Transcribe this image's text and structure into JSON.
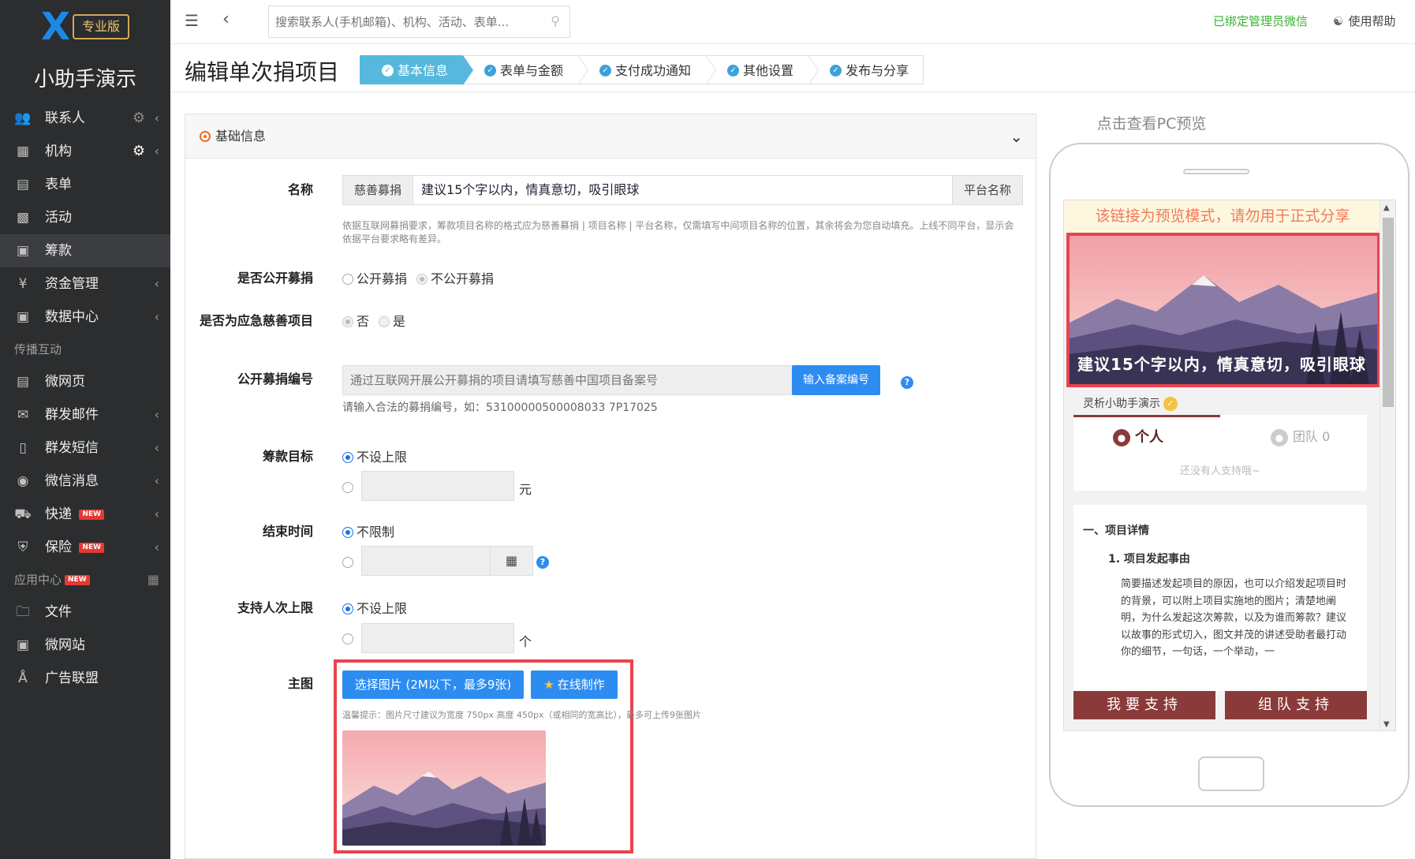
{
  "sidebar": {
    "logo_badge": "专业版",
    "app_name": "小助手演示",
    "items": [
      {
        "label": "联系人",
        "icon": "users-icon"
      },
      {
        "label": "机构",
        "icon": "building-icon"
      },
      {
        "label": "表单",
        "icon": "clipboard-icon"
      },
      {
        "label": "活动",
        "icon": "calendar-icon"
      },
      {
        "label": "筹款",
        "icon": "money-icon"
      },
      {
        "label": "资金管理",
        "icon": "yen-icon"
      },
      {
        "label": "数据中心",
        "icon": "data-icon"
      }
    ],
    "group_share": "传播互动",
    "share_items": [
      {
        "label": "微网页",
        "icon": "file-icon"
      },
      {
        "label": "群发邮件",
        "icon": "mail-icon"
      },
      {
        "label": "群发短信",
        "icon": "phone-icon"
      },
      {
        "label": "微信消息",
        "icon": "wechat-icon"
      },
      {
        "label": "快递",
        "icon": "truck-icon",
        "badge": "NEW"
      },
      {
        "label": "保险",
        "icon": "shield-icon",
        "badge": "NEW"
      }
    ],
    "group_apps": "应用中心",
    "group_apps_badge": "NEW",
    "app_items": [
      {
        "label": "文件",
        "icon": "folder-icon"
      },
      {
        "label": "微网站",
        "icon": "site-icon"
      },
      {
        "label": "广告联盟",
        "icon": "ad-icon"
      }
    ]
  },
  "topbar": {
    "search_placeholder": "搜索联系人(手机邮箱)、机构、活动、表单...",
    "wechat_bound": "已绑定管理员微信",
    "help": "使用帮助"
  },
  "page": {
    "title": "编辑单次捐项目",
    "steps": [
      "基本信息",
      "表单与金额",
      "支付成功通知",
      "其他设置",
      "发布与分享"
    ]
  },
  "form": {
    "section_title": "基础信息",
    "name_label": "名称",
    "name_prefix": "慈善募捐",
    "name_value": "建议15个字以内，情真意切，吸引眼球",
    "name_suffix": "平台名称",
    "name_hint": "依据互联网募捐要求，筹款项目名称的格式应为慈善募捐 | 项目名称 | 平台名称，仅需填写中间项目名称的位置，其余将会为您自动填充。上线不同平台，显示会依据平台要求略有差异。",
    "public_label": "是否公开募捐",
    "public_opt1": "公开募捐",
    "public_opt2": "不公开募捐",
    "emergency_label": "是否为应急慈善项目",
    "emergency_opt1": "否",
    "emergency_opt2": "是",
    "record_label": "公开募捐编号",
    "record_placeholder": "通过互联网开展公开募捐的项目请填写慈善中国项目备案号",
    "record_button": "输入备案编号",
    "record_hint": "请输入合法的募捐编号，如：53100000500008033 7P17025",
    "goal_label": "筹款目标",
    "goal_opt1": "不设上限",
    "goal_unit": "元",
    "end_label": "结束时间",
    "end_opt1": "不限制",
    "limit_label": "支持人次上限",
    "limit_opt1": "不设上限",
    "limit_unit": "个",
    "image_label": "主图",
    "image_select": "选择图片 (2M以下，最多9张)",
    "image_online": "在线制作",
    "image_hint": "温馨提示：图片尺寸建议为宽度 750px 高度 450px（或相同的宽高比），最多可上传9张图片"
  },
  "preview": {
    "title": "点击查看PC预览",
    "warning": "该链接为预览模式，请勿用于正式分享",
    "banner_caption": "建议15个字以内，情真意切，吸引眼球",
    "org_name": "灵析小助手演示",
    "tab_personal": "个人",
    "tab_team": "团队 0",
    "empty_text": "还没有人支持哦~",
    "detail_h1": "一、项目详情",
    "detail_h2": "1. 项目发起事由",
    "detail_p": "简要描述发起项目的原因，也可以介绍发起项目时的背景，可以附上项目实施地的图片；清楚地阐明，为什么发起这次筹款，以及为谁而筹款？建议以故事的形式切入，图文并茂的讲述受助者最打动你的细节，一句话，一个举动，一",
    "btn_support": "我要支持",
    "btn_team": "组队支持"
  },
  "colors": {
    "accent_blue": "#2d8cf0",
    "step_active": "#56b8dd",
    "highlight_red": "#e8434e",
    "theme_maroon": "#8b3a3a"
  }
}
